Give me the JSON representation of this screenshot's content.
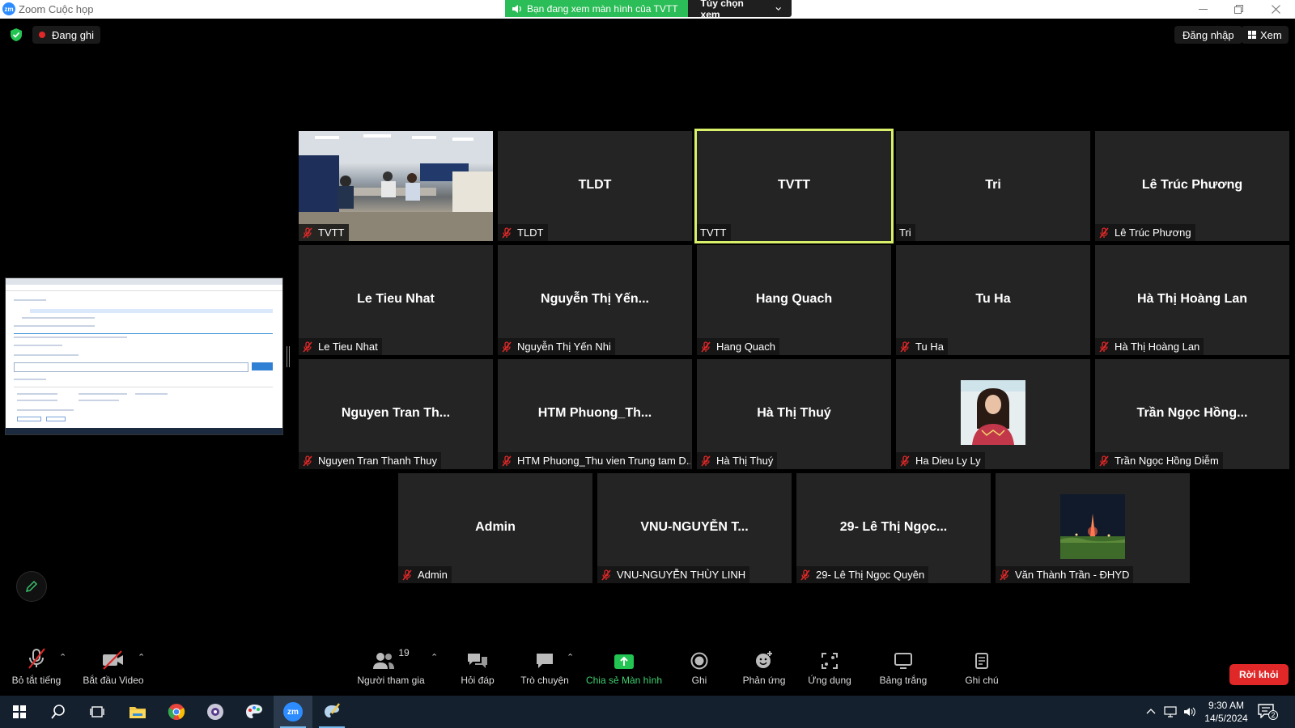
{
  "window": {
    "title": "Zoom Cuộc họp",
    "logo_text": "zm",
    "viewing_banner": "Bạn đang xem màn hình của TVTT",
    "view_options": "Tùy chọn xem"
  },
  "top_bar": {
    "recording_label": "Đang ghi",
    "login_label": "Đăng nhập",
    "view_label": "Xem"
  },
  "participants": [
    {
      "big": "",
      "name": "TVTT",
      "muted": true,
      "media": "room-video"
    },
    {
      "big": "TLDT",
      "name": "TLDT",
      "muted": true
    },
    {
      "big": "TVTT",
      "name": "TVTT",
      "muted": false,
      "active": true
    },
    {
      "big": "Tri",
      "name": "Tri",
      "muted": false
    },
    {
      "big": "Lê Trúc Phương",
      "name": "Lê Trúc Phương",
      "muted": true
    },
    {
      "big": "Le Tieu Nhat",
      "name": "Le Tieu Nhat",
      "muted": true
    },
    {
      "big": "Nguyễn Thị Yến...",
      "name": "Nguyễn Thị Yến Nhi",
      "muted": true
    },
    {
      "big": "Hang Quach",
      "name": "Hang Quach",
      "muted": true
    },
    {
      "big": "Tu Ha",
      "name": "Tu Ha",
      "muted": true
    },
    {
      "big": "Hà Thị Hoàng Lan",
      "name": "Hà Thị Hoàng Lan",
      "muted": true
    },
    {
      "big": "Nguyen Tran Th...",
      "name": "Nguyen Tran Thanh Thuy",
      "muted": true
    },
    {
      "big": "HTM  Phuong_Th...",
      "name": "HTM Phuong_Thu vien Trung tam D...",
      "muted": true
    },
    {
      "big": "Hà Thị Thuý",
      "name": "Hà Thị Thuý",
      "muted": true
    },
    {
      "big": "",
      "name": "Ha Dieu Ly Ly",
      "muted": true,
      "media": "avatar-woman"
    },
    {
      "big": "Trần Ngọc Hồng...",
      "name": "Trần Ngọc Hồng Diễm",
      "muted": true
    },
    {
      "big": "Admin",
      "name": "Admin",
      "muted": true
    },
    {
      "big": "VNU-NGUYỄN  T...",
      "name": "VNU-NGUYỄN THÙY LINH",
      "muted": true
    },
    {
      "big": "29- Lê Thị Ngọc...",
      "name": "29- Lê Thị Ngọc Quyên",
      "muted": true
    },
    {
      "big": "",
      "name": "Văn Thành Trần - ĐHYD",
      "muted": true,
      "media": "avatar-night"
    }
  ],
  "toolbar": {
    "unmute_all": "Bỏ tắt tiếng",
    "start_video": "Bắt đầu Video",
    "participants_label": "Người tham gia",
    "participants_count": "19",
    "qa": "Hỏi đáp",
    "chat": "Trò chuyện",
    "share_screen": "Chia sẻ Màn hình",
    "record": "Ghi",
    "reactions": "Phản ứng",
    "apps": "Ứng dụng",
    "whiteboard": "Bảng trắng",
    "notes": "Ghi chú",
    "leave": "Rời khỏi"
  },
  "taskbar": {
    "time": "9:30 AM",
    "date": "14/5/2024",
    "notif_count": "2",
    "zoom_label": "zm"
  },
  "colors": {
    "accent_green": "#2bbd57",
    "active_speaker": "#d8f06a",
    "leave_red": "#e02828",
    "tile_bg": "#242424"
  }
}
